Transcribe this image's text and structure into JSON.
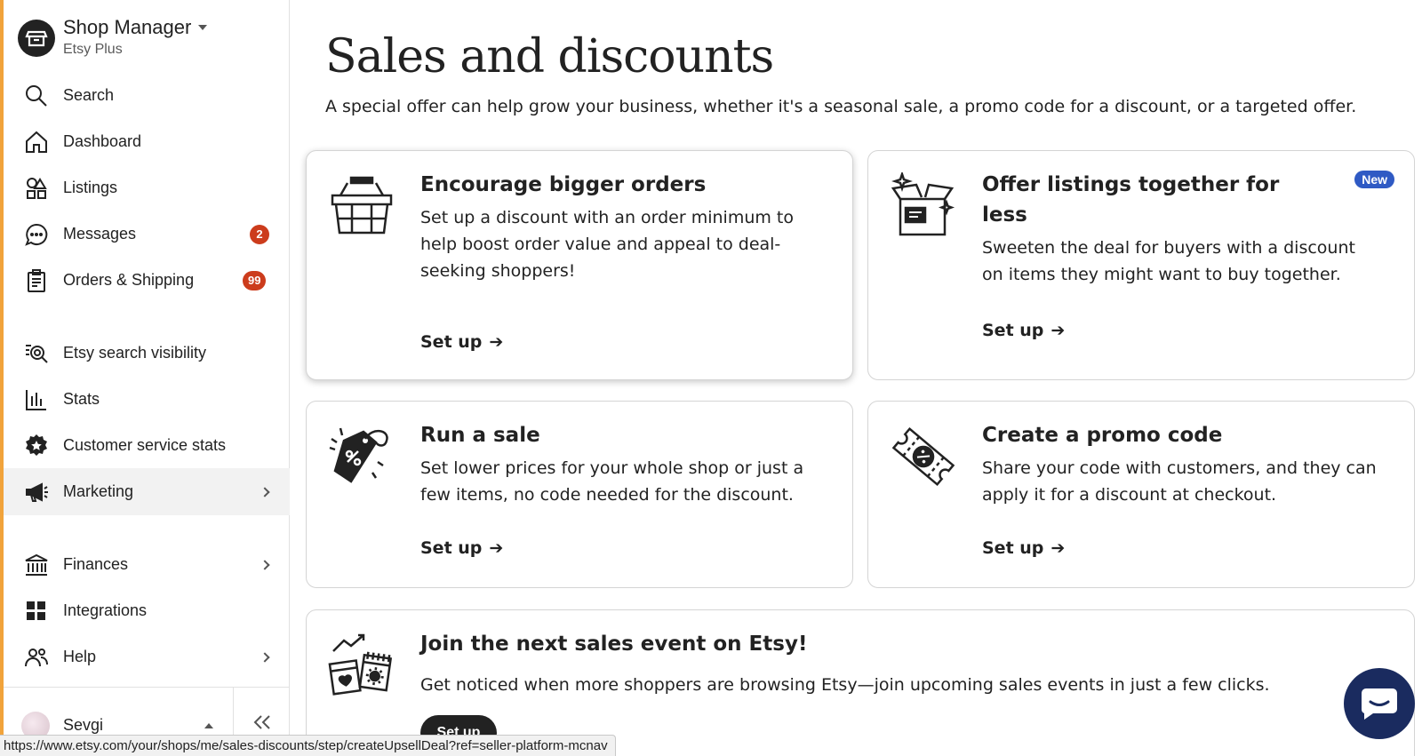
{
  "sidebar": {
    "shop_title": "Shop Manager",
    "shop_subtitle": "Etsy Plus",
    "items": [
      {
        "label": "Search",
        "icon": "search-icon"
      },
      {
        "label": "Dashboard",
        "icon": "home-icon"
      },
      {
        "label": "Listings",
        "icon": "shapes-icon"
      },
      {
        "label": "Messages",
        "icon": "chat-icon",
        "badge": "2"
      },
      {
        "label": "Orders & Shipping",
        "icon": "clipboard-icon",
        "badge": "99"
      },
      {
        "label": "Etsy search visibility",
        "icon": "search-list-icon"
      },
      {
        "label": "Stats",
        "icon": "bar-chart-icon"
      },
      {
        "label": "Customer service stats",
        "icon": "star-badge-icon"
      },
      {
        "label": "Marketing",
        "icon": "megaphone-icon",
        "active": true
      },
      {
        "label": "Finances",
        "icon": "bank-icon"
      },
      {
        "label": "Integrations",
        "icon": "grid-icon"
      },
      {
        "label": "Help",
        "icon": "people-icon"
      }
    ],
    "user_name": "Sevgi"
  },
  "main": {
    "title": "Sales and discounts",
    "description": "A special offer can help grow your business, whether it's a seasonal sale, a promo code for a discount, or a targeted offer.",
    "cards": [
      {
        "title": "Encourage bigger orders",
        "body_lines": [
          "Set up a discount with an order minimum to",
          "help boost order value and appeal to deal-",
          "seeking shoppers!"
        ],
        "link": "Set up",
        "icon": "basket-icon"
      },
      {
        "title_lines": [
          "Offer listings together for",
          "less"
        ],
        "body_lines": [
          "Sweeten the deal for buyers with a discount",
          "on items they might want to buy together."
        ],
        "link": "Set up",
        "badge": "New",
        "icon": "open-box-icon"
      },
      {
        "title": "Run a sale",
        "body_lines": [
          "Set lower prices for your whole shop or just a",
          "few items, no code needed for the discount."
        ],
        "link": "Set up",
        "icon": "price-tag-icon"
      },
      {
        "title": "Create a promo code",
        "body_lines": [
          "Share your code with customers, and they can",
          "apply it for a discount at checkout."
        ],
        "link": "Set up",
        "icon": "coupon-icon"
      }
    ],
    "event": {
      "title": "Join the next sales event on Etsy!",
      "body": "Get noticed when more shoppers are browsing Etsy—join upcoming sales events in just a few clicks.",
      "button": "Set up",
      "icon": "calendar-event-icon"
    }
  },
  "status_bar": {
    "url": "https://www.etsy.com/your/shops/me/sales-discounts/step/createUpsellDeal?ref=seller-platform-mcnav"
  },
  "colors": {
    "sidebar_accent": "#f1a33b",
    "badge_red": "#cc3c1c",
    "new_badge_blue": "#2f5ac4",
    "chat_button": "#1a2b5f"
  }
}
